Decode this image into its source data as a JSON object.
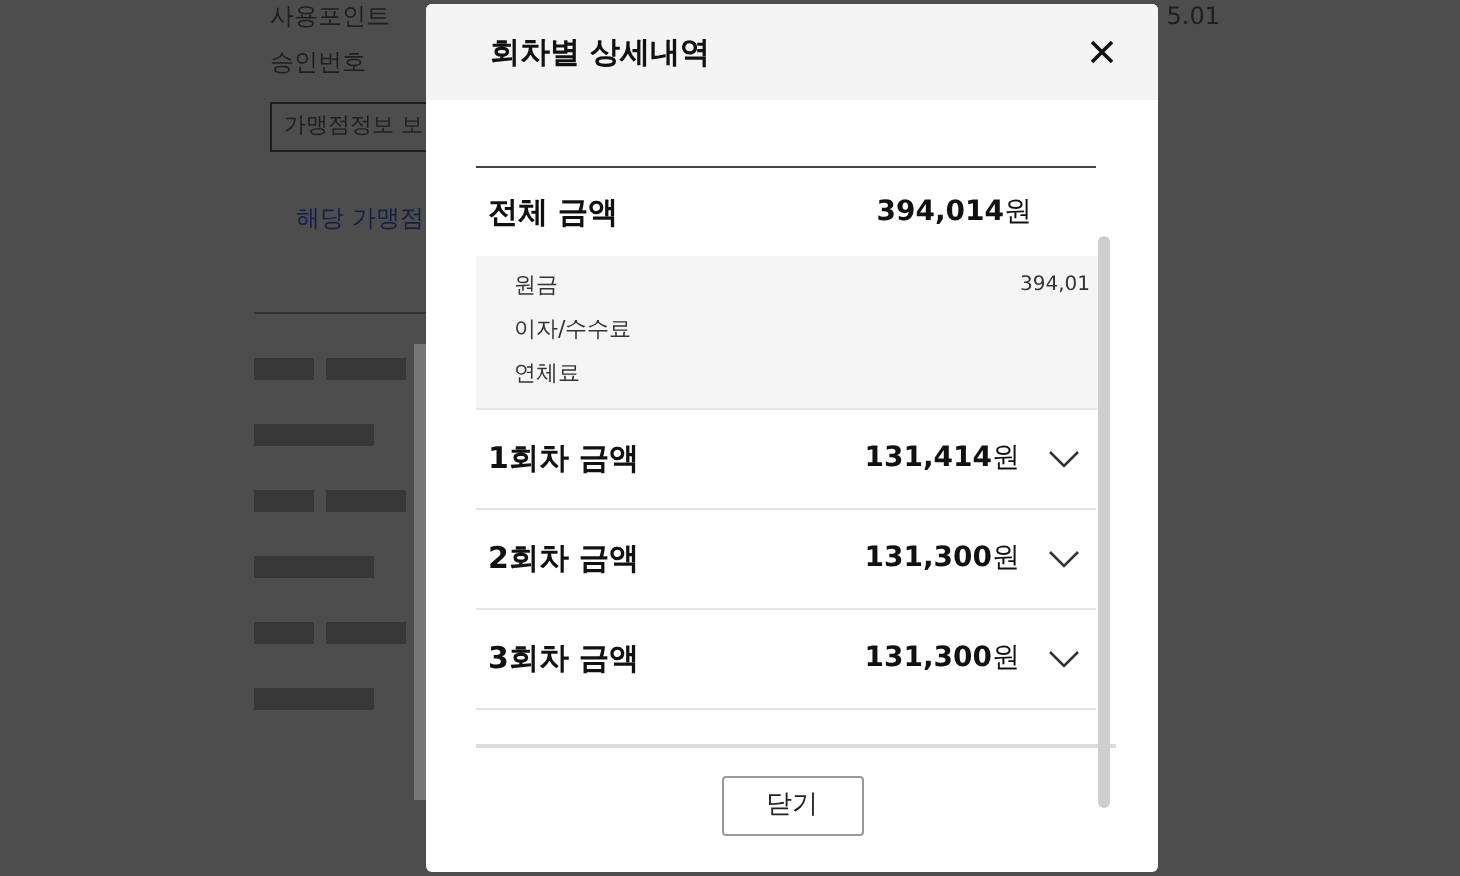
{
  "background": {
    "rows": [
      {
        "label": "사용포인트",
        "value": "5.01"
      },
      {
        "label": "승인번호"
      }
    ],
    "store_button": "가맹점정보 보",
    "store_link": "해당 가맹점"
  },
  "dialog": {
    "title": "회차별 상세내역",
    "total": {
      "label": "전체 금액",
      "amount": "394,014",
      "unit": "원"
    },
    "breakdown": [
      {
        "label": "원금",
        "value": "394,01"
      },
      {
        "label": "이자/수수료"
      },
      {
        "label": "연체료"
      }
    ],
    "installments": [
      {
        "label": "1회차 금액",
        "amount": "131,414",
        "unit": "원",
        "expanded": false
      },
      {
        "label": "2회차 금액",
        "amount": "131,300",
        "unit": "원",
        "expanded": false
      },
      {
        "label": "3회차 금액",
        "amount": "131,300",
        "unit": "원",
        "expanded": false
      }
    ],
    "close_button": "닫기"
  }
}
